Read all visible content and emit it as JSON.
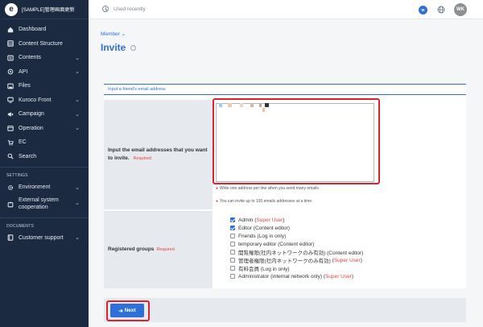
{
  "app": {
    "title": "[SAMPLE]管理画面更新",
    "logo": "e"
  },
  "sidebar": {
    "items": [
      {
        "label": "Dashboard",
        "icon": "home-icon",
        "chevron": false
      },
      {
        "label": "Content Structure",
        "icon": "database-icon",
        "chevron": false
      },
      {
        "label": "Contents",
        "icon": "folder-icon",
        "chevron": true
      },
      {
        "label": "API",
        "icon": "code-icon",
        "chevron": true
      },
      {
        "label": "Files",
        "icon": "image-icon",
        "chevron": false
      },
      {
        "label": "Kuroco Front",
        "icon": "monitor-icon",
        "chevron": true
      },
      {
        "label": "Campaign",
        "icon": "megaphone-icon",
        "chevron": true
      },
      {
        "label": "Operation",
        "icon": "calendar-icon",
        "chevron": true
      },
      {
        "label": "EC",
        "icon": "cart-icon",
        "chevron": false
      },
      {
        "label": "Search",
        "icon": "search-icon",
        "chevron": false
      }
    ],
    "settings_label": "SETTINGS",
    "settings_items": [
      {
        "label": "Environment",
        "icon": "gear-icon",
        "chevron": true
      },
      {
        "label_line1": "External system",
        "label_line2": "cooperation",
        "icon": "puzzle-icon",
        "chevron": true
      }
    ],
    "documents_label": "DOCUMENTS",
    "documents_items": [
      {
        "label": "Customer support",
        "icon": "book-icon",
        "chevron": true
      }
    ]
  },
  "topbar": {
    "recent_label": "Used recently",
    "workspace_badge": "w",
    "avatar_initials": "WK"
  },
  "breadcrumb": {
    "label": "Member"
  },
  "page": {
    "title": "Invite"
  },
  "form": {
    "header": "Input a friend's email address",
    "email_label_line1": "Input the email addresses that you want",
    "email_label_line2": "to invite.",
    "required": "Required",
    "email_value": "",
    "hint1": "Write one address per line when you send many emails.",
    "hint2": "You can invite up to 100 emails addresses at a time.",
    "groups_label": "Registered groups",
    "groups": [
      {
        "label": "Admin",
        "checked": true,
        "super": "Super User",
        "note": ""
      },
      {
        "label": "Editor (Content editor)",
        "checked": true,
        "super": "",
        "note": ""
      },
      {
        "label": "Friends (Log in only)",
        "checked": false,
        "super": "",
        "note": ""
      },
      {
        "label": "temporary editor (Content editor)",
        "checked": false,
        "super": "",
        "note": ""
      },
      {
        "label": "閲覧権限(社内ネットワークのみ有効) (Content editor)",
        "checked": false,
        "super": "",
        "note": ""
      },
      {
        "label": "管理者権限(社内ネットワークのみ有効)",
        "checked": false,
        "super": "Super User",
        "note": ""
      },
      {
        "label": "有料会員 (Log in only)",
        "checked": false,
        "super": "",
        "note": ""
      },
      {
        "label": "Administrator (internal network only)",
        "checked": false,
        "super": "Super User",
        "note": ""
      }
    ]
  },
  "actions": {
    "next_label": "Next"
  },
  "colors": {
    "sidebar": "#1b2a41",
    "accent": "#2f6fd8",
    "highlight": "#d9232d",
    "required": "#e04444"
  }
}
